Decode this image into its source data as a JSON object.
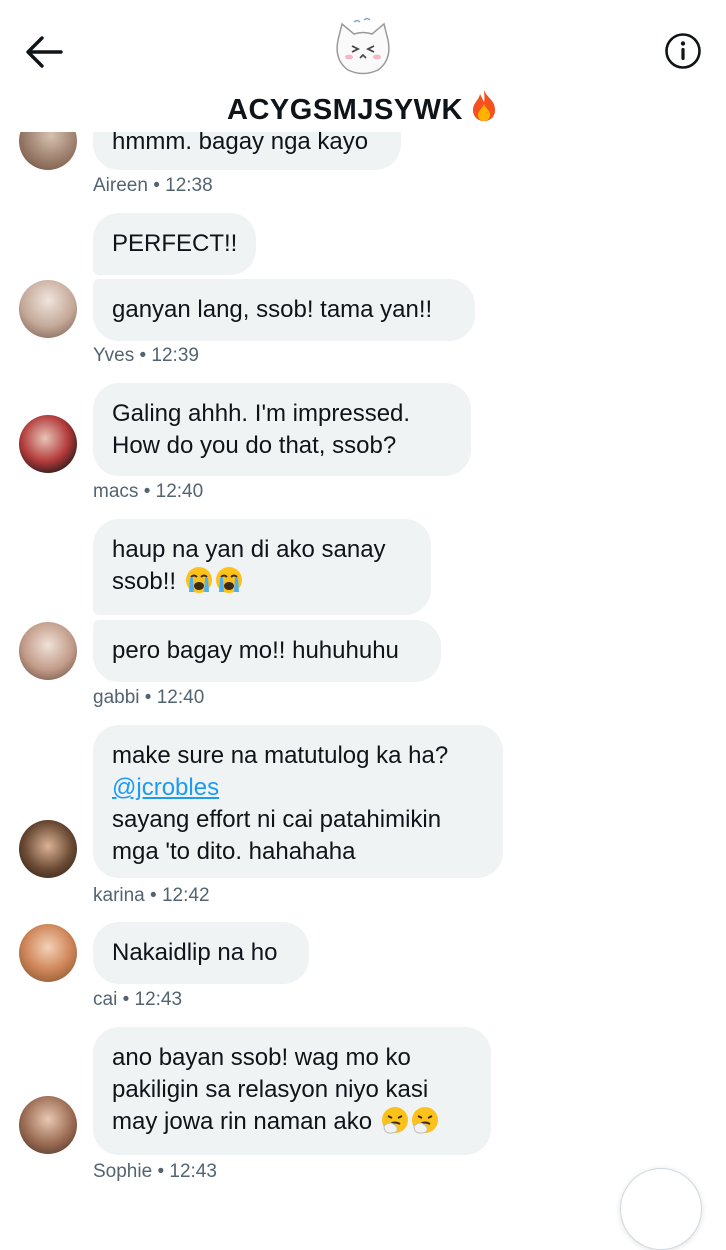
{
  "header": {
    "title": "ACYGSMJSYWK",
    "back_icon": "arrow-left-icon",
    "info_icon": "info-icon",
    "group_avatar": "cat-face-avatar",
    "title_emoji": "fire-emoji"
  },
  "messages": [
    {
      "text": "hmmm. bagay nga kayo"
    },
    {
      "text": "PERFECT!!"
    },
    {
      "text": "ganyan lang, ssob! tama yan!!"
    },
    {
      "line1": "Galing ahhh. I'm impressed.",
      "line2": "How do you do that, ssob?"
    },
    {
      "line1": "haup na yan di ako sanay",
      "line2": "ssob!!"
    },
    {
      "text": "pero bagay mo!! huhuhuhu"
    },
    {
      "line1": "make sure na matutulog ka ha?",
      "mention": "@jcrobles",
      "line3": "sayang effort ni cai patahimikin",
      "line4": "mga 'to dito. hahahaha"
    },
    {
      "text": "Nakaidlip na ho"
    },
    {
      "line1": "ano bayan ssob! wag mo ko",
      "line2": "pakiligin sa relasyon niyo kasi",
      "line3": "may jowa rin naman ako"
    }
  ],
  "meta": [
    {
      "sender": "Aireen",
      "sep": "•",
      "time": "12:38"
    },
    {
      "sender": "Yves",
      "sep": "•",
      "time": "12:39"
    },
    {
      "sender": "macs",
      "sep": "•",
      "time": "12:40"
    },
    {
      "sender": "gabbi",
      "sep": "•",
      "time": "12:40"
    },
    {
      "sender": "karina",
      "sep": "•",
      "time": "12:42"
    },
    {
      "sender": "cai",
      "sep": "•",
      "time": "12:43"
    },
    {
      "sender": "Sophie",
      "sep": "•",
      "time": "12:43"
    }
  ],
  "emojis": {
    "crying": "loudly-crying-emoji",
    "sneezing": "sneezing-face-emoji"
  }
}
